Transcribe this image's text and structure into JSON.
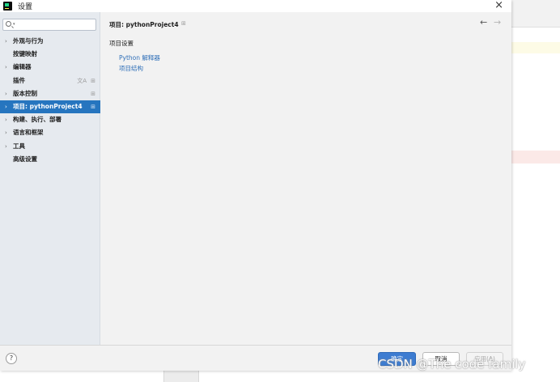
{
  "window": {
    "title": "设置"
  },
  "search": {
    "placeholder": ""
  },
  "sidebar": {
    "items": [
      {
        "label": "外观与行为",
        "expandable": true,
        "selected": false,
        "gear": false
      },
      {
        "label": "按键映射",
        "expandable": false,
        "selected": false,
        "gear": false
      },
      {
        "label": "编辑器",
        "expandable": true,
        "selected": false,
        "gear": false
      },
      {
        "label": "插件",
        "expandable": false,
        "selected": false,
        "gear": true
      },
      {
        "label": "版本控制",
        "expandable": true,
        "selected": false,
        "gear": true
      },
      {
        "label": "项目: pythonProject4",
        "expandable": true,
        "selected": true,
        "gear": true
      },
      {
        "label": "构建、执行、部署",
        "expandable": true,
        "selected": false,
        "gear": false
      },
      {
        "label": "语言和框架",
        "expandable": true,
        "selected": false,
        "gear": false
      },
      {
        "label": "工具",
        "expandable": true,
        "selected": false,
        "gear": false
      },
      {
        "label": "高级设置",
        "expandable": false,
        "selected": false,
        "gear": false
      }
    ]
  },
  "content": {
    "breadcrumb": "项目: pythonProject4",
    "section_title": "项目设置",
    "links": [
      "Python 解释器",
      "项目结构"
    ]
  },
  "footer": {
    "help": "?",
    "ok_label": "确定",
    "cancel_label": "取消",
    "apply_label": "应用(A)"
  },
  "watermark": "CSDN @The code family",
  "icons": {
    "close": "close-icon",
    "search": "search-icon",
    "gear": "gear-icon",
    "back": "arrow-left-icon",
    "forward": "arrow-right-icon",
    "help": "help-icon"
  },
  "colors": {
    "selection": "#2675bf",
    "link": "#2f6fb8",
    "primary_button": "#3d7cd1"
  }
}
